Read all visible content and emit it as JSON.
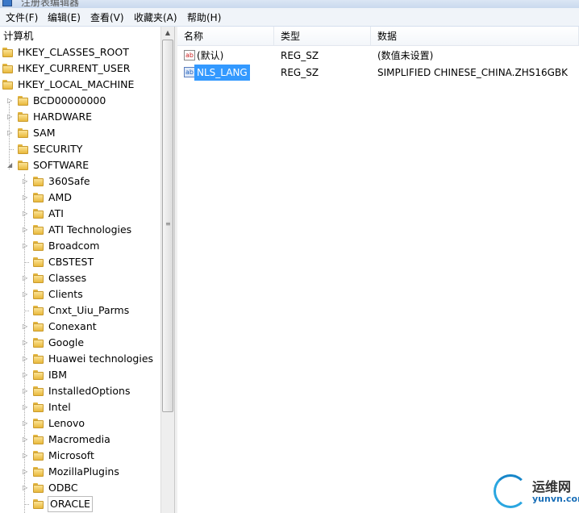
{
  "window": {
    "title": "注册表编辑器"
  },
  "menu": [
    "文件(F)",
    "编辑(E)",
    "查看(V)",
    "收藏夹(A)",
    "帮助(H)"
  ],
  "tree": {
    "root": "计算机",
    "hives": [
      "HKEY_CLASSES_ROOT",
      "HKEY_CURRENT_USER",
      "HKEY_LOCAL_MACHINE"
    ],
    "hklm_children": [
      "BCD00000000",
      "HARDWARE",
      "SAM",
      "SECURITY",
      "SOFTWARE"
    ],
    "software_children": [
      "360Safe",
      "AMD",
      "ATI",
      "ATI Technologies",
      "Broadcom",
      "CBSTEST",
      "Classes",
      "Clients",
      "Cnxt_Uiu_Parms",
      "Conexant",
      "Google",
      "Huawei technologies",
      "IBM",
      "InstalledOptions",
      "Intel",
      "Lenovo",
      "Macromedia",
      "Microsoft",
      "MozillaPlugins",
      "ODBC",
      "ORACLE"
    ],
    "selected": "ORACLE"
  },
  "list": {
    "columns": [
      "名称",
      "类型",
      "数据"
    ],
    "rows": [
      {
        "name": "(默认)",
        "type": "REG_SZ",
        "data": "(数值未设置)",
        "icon": "string-value-icon"
      },
      {
        "name": "NLS_LANG",
        "type": "REG_SZ",
        "data": "SIMPLIFIED CHINESE_CHINA.ZHS16GBK",
        "icon": "string-value-icon"
      }
    ],
    "selected": "NLS_LANG"
  },
  "watermark": {
    "text": "运维网",
    "url": "yunvn.com"
  }
}
